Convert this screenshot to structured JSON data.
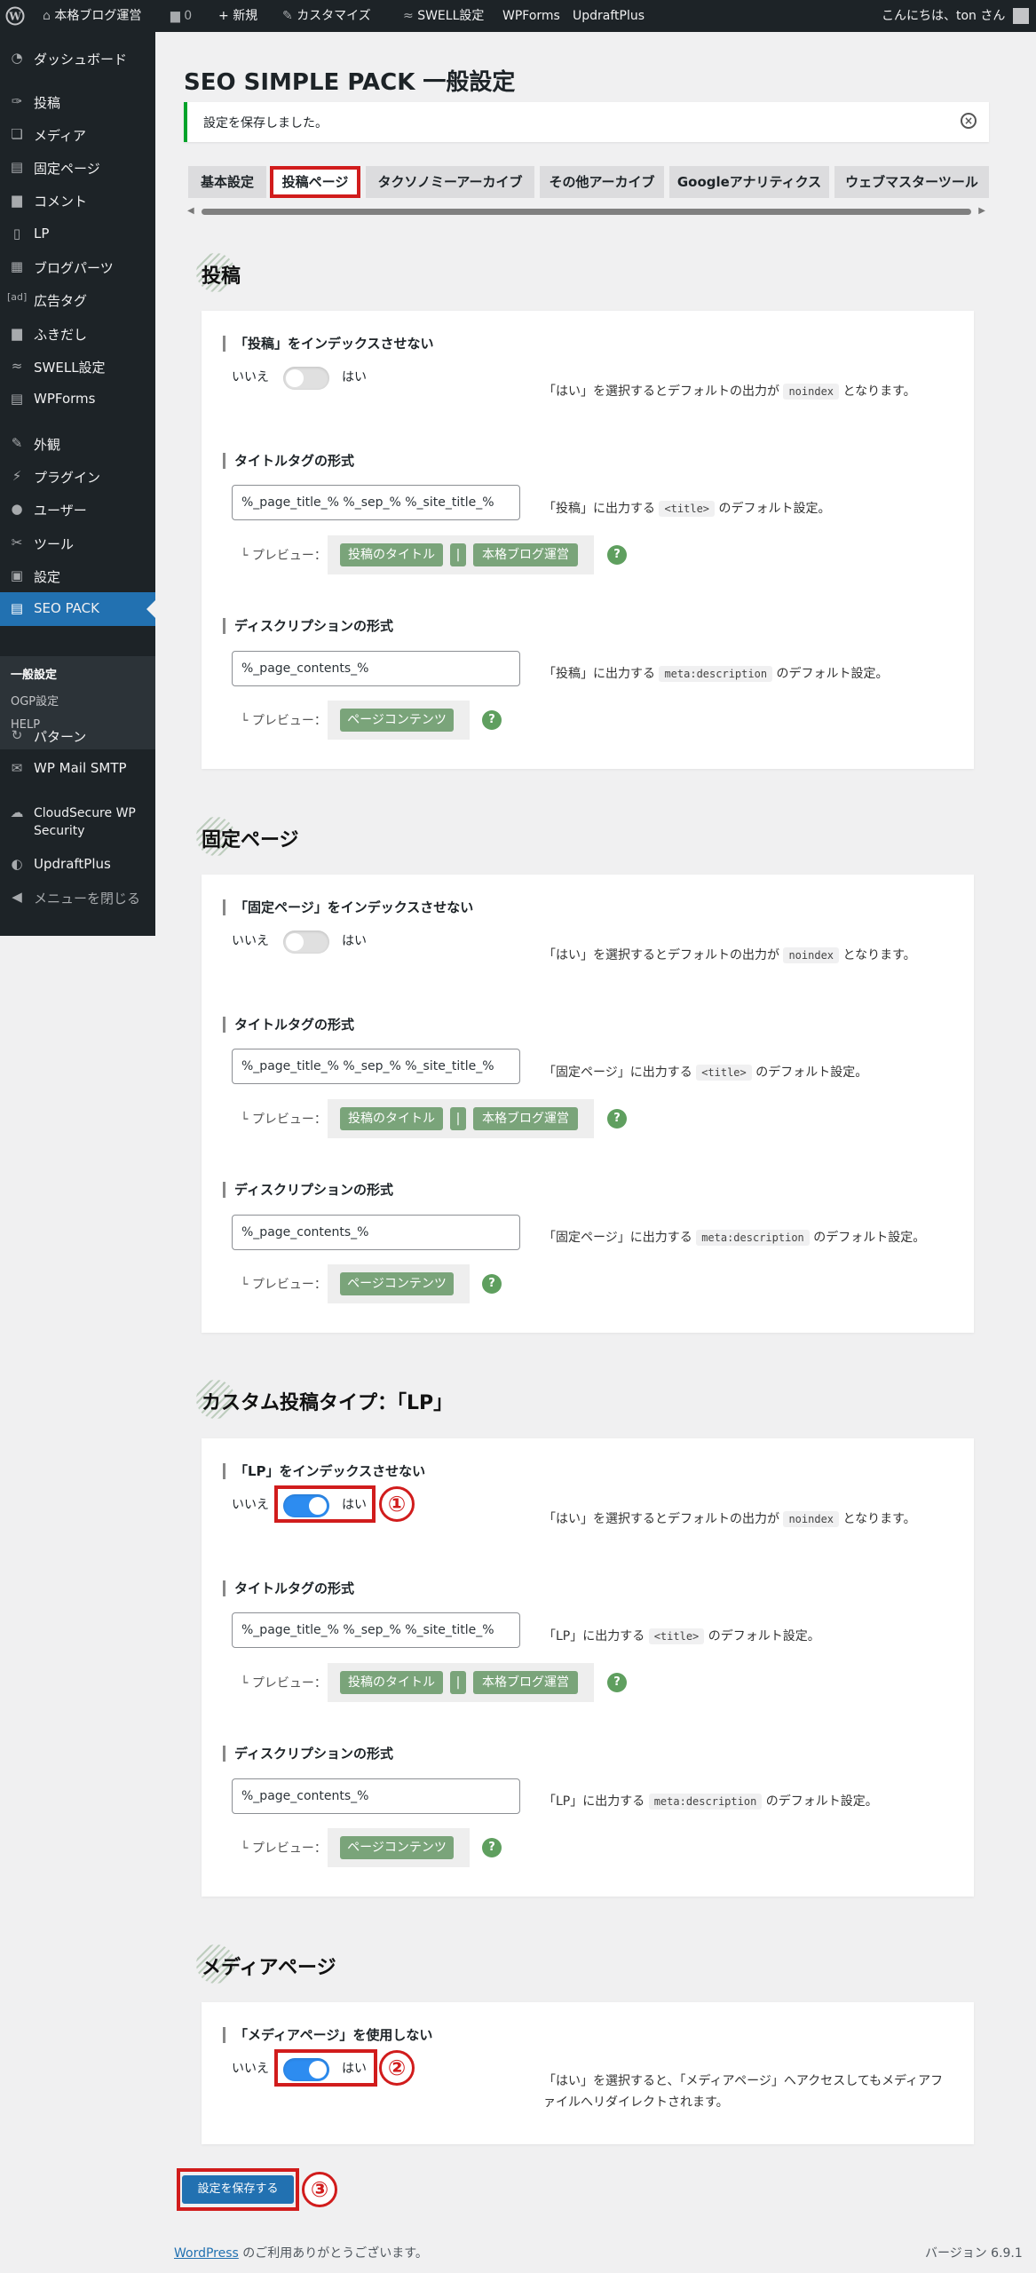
{
  "adminbar": {
    "site_name": "本格ブログ運営",
    "comments_count": "0",
    "new_label": "新規",
    "customize_label": "カスタマイズ",
    "swell_label": "SWELL設定",
    "wpforms_label": "WPForms",
    "updraft_label": "UpdraftPlus",
    "greeting": "こんにちは、ton さん"
  },
  "sidebar": {
    "items": [
      {
        "icon": "dashboard-icon",
        "label": "ダッシュボード"
      },
      {
        "icon": "pin-icon",
        "label": "投稿"
      },
      {
        "icon": "media-icon",
        "label": "メディア"
      },
      {
        "icon": "page-icon",
        "label": "固定ページ"
      },
      {
        "icon": "comment-icon",
        "label": "コメント"
      },
      {
        "icon": "lp-icon",
        "label": "LP"
      },
      {
        "icon": "blog-parts-icon",
        "label": "ブログパーツ"
      },
      {
        "icon": "ad-icon",
        "label": "広告タグ"
      },
      {
        "icon": "balloon-icon",
        "label": "ふきだし"
      },
      {
        "icon": "swell-icon",
        "label": "SWELL設定"
      },
      {
        "icon": "wpforms-icon",
        "label": "WPForms"
      },
      {
        "icon": "appearance-icon",
        "label": "外観"
      },
      {
        "icon": "plugin-icon",
        "label": "プラグイン"
      },
      {
        "icon": "user-icon",
        "label": "ユーザー"
      },
      {
        "icon": "tool-icon",
        "label": "ツール"
      },
      {
        "icon": "settings-icon",
        "label": "設定"
      },
      {
        "icon": "seo-pack-icon",
        "label": "SEO PACK"
      },
      {
        "icon": "pattern-icon",
        "label": "パターン"
      },
      {
        "icon": "mail-icon",
        "label": "WP Mail SMTP"
      },
      {
        "icon": "cloudsecure-icon",
        "label": "CloudSecure WP Security"
      },
      {
        "icon": "updraft-icon",
        "label": "UpdraftPlus"
      },
      {
        "icon": "collapse-icon",
        "label": "メニューを閉じる"
      }
    ],
    "submenu": [
      "一般設定",
      "OGP設定",
      "HELP"
    ]
  },
  "page": {
    "title": "SEO SIMPLE PACK 一般設定",
    "notice": "設定を保存しました。"
  },
  "tabs": [
    "基本設定",
    "投稿ページ",
    "タクソノミーアーカイブ",
    "その他アーカイブ",
    "Googleアナリティクス",
    "ウェブマスターツール"
  ],
  "common": {
    "no": "いいえ",
    "yes": "はい",
    "title_format_label": "タイトルタグの形式",
    "desc_format_label": "ディスクリプションの形式",
    "preview_label": "└ プレビュー：",
    "title_value": "%_page_title_% %_sep_% %_site_title_%",
    "desc_value": "%_page_contents_%",
    "chip_post_title": "投稿のタイトル",
    "chip_sep": "|",
    "chip_site": "本格ブログ運営",
    "chip_contents": "ページコンテンツ",
    "q": "?",
    "noindex_desc_pre": "「はい」を選択するとデフォルトの出力が",
    "noindex_code": "noindex",
    "noindex_desc_post": "となります。",
    "title_code": "<title>",
    "meta_code": "meta:description",
    "default_setting": "のデフォルト設定。"
  },
  "sections": {
    "post": {
      "heading": "投稿",
      "index_label": "「投稿」をインデックスさせない",
      "prefix": "「投稿」に出力する"
    },
    "page": {
      "heading": "固定ページ",
      "index_label": "「固定ページ」をインデックスさせない",
      "prefix": "「固定ページ」に出力する"
    },
    "lp": {
      "heading": "カスタム投稿タイプ：「LP」",
      "index_label": "「LP」をインデックスさせない",
      "prefix": "「LP」に出力する",
      "badge": "①"
    },
    "media": {
      "heading": "メディアページ",
      "label": "「メディアページ」を使用しない",
      "desc1": "「はい」を選択すると、「メディアページ」へアクセスしてもメディアフ",
      "desc2": "ァイルへリダイレクトされます。",
      "badge": "②"
    }
  },
  "save_button": "設定を保存する",
  "save_badge": "③",
  "footer": {
    "wp_link": "WordPress",
    "thanks": " のご利用ありがとうございます。",
    "version": "バージョン 6.9.1"
  }
}
